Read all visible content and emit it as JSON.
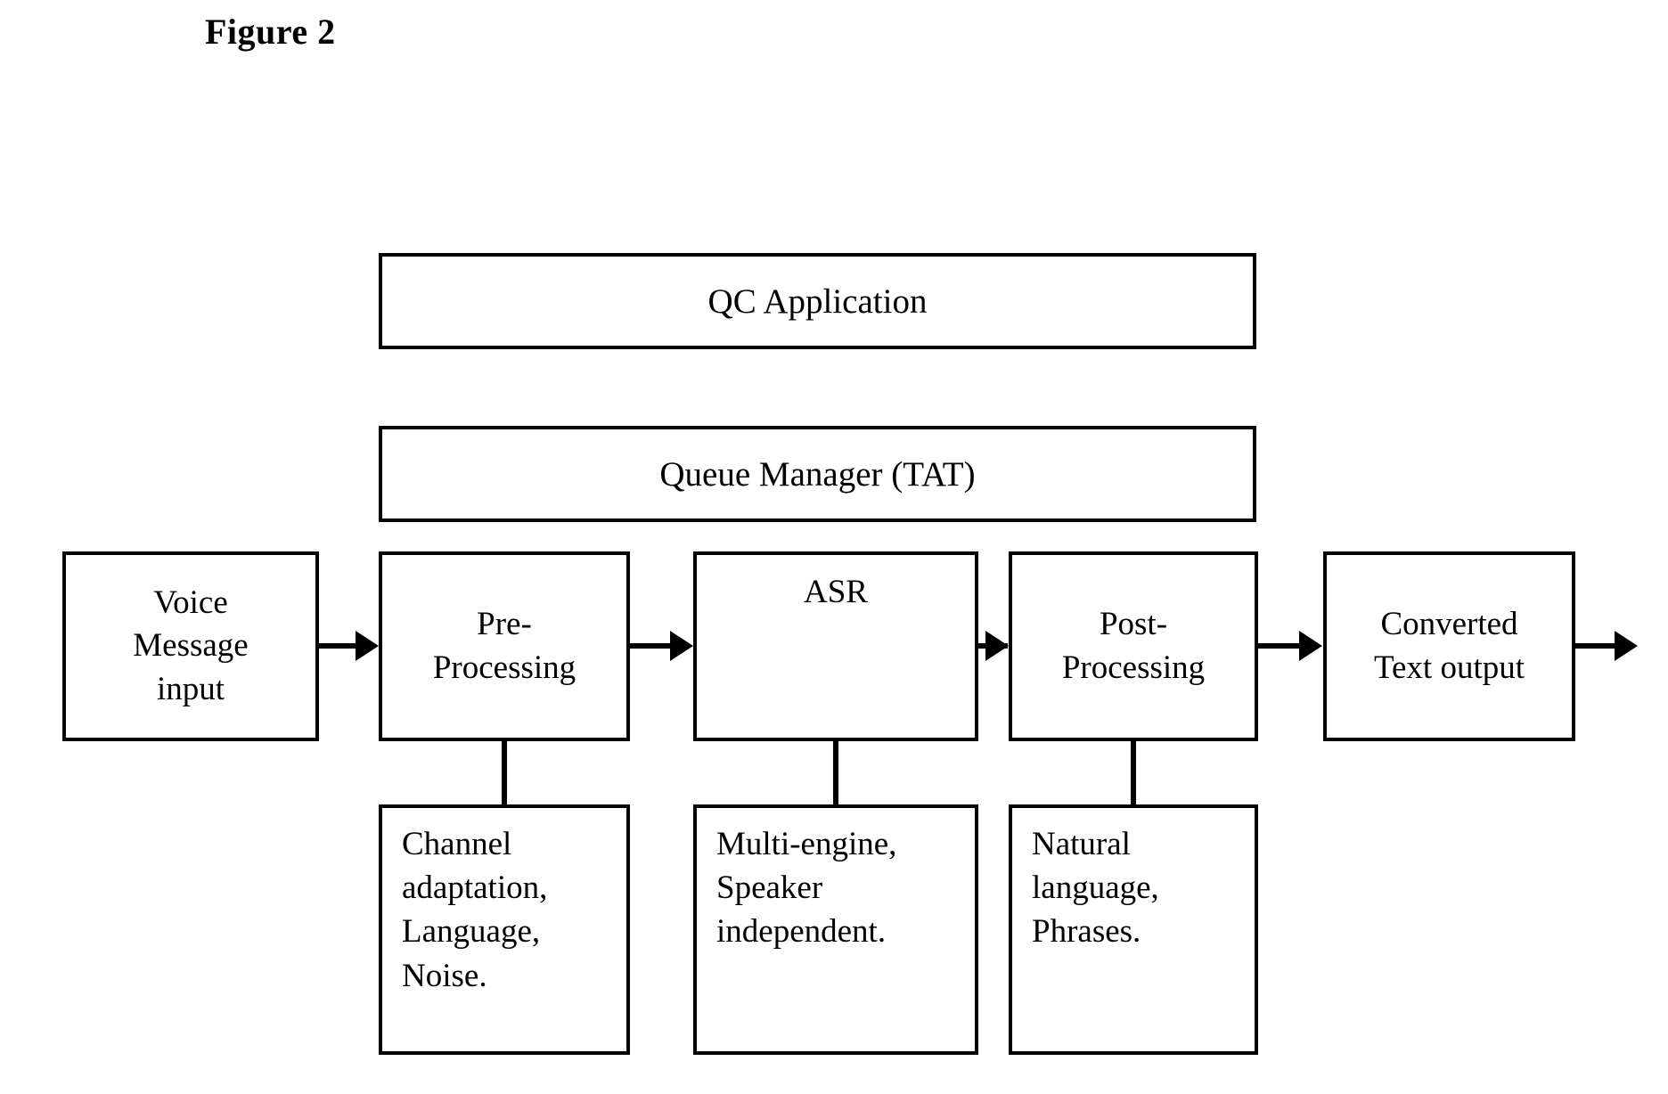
{
  "figure": {
    "title": "Figure 2"
  },
  "bands": [
    {
      "id": "qc-application",
      "label": "QC Application"
    },
    {
      "id": "queue-manager",
      "label": "Queue Manager (TAT)"
    }
  ],
  "pipeline": [
    {
      "id": "voice-message-input",
      "lines": [
        "Voice",
        "Message",
        "input"
      ]
    },
    {
      "id": "pre-processing",
      "lines": [
        "Pre-",
        "Processing"
      ]
    },
    {
      "id": "asr",
      "lines": [
        "ASR"
      ]
    },
    {
      "id": "post-processing",
      "lines": [
        "Post-",
        "Processing"
      ]
    },
    {
      "id": "converted-text-output",
      "lines": [
        "Converted",
        "Text output"
      ]
    }
  ],
  "details": [
    {
      "id": "pre-processing-details",
      "parent": "pre-processing",
      "lines": [
        "Channel",
        "adaptation,",
        "Language,",
        "Noise."
      ]
    },
    {
      "id": "asr-details",
      "parent": "asr",
      "lines": [
        "Multi-engine,",
        "Speaker",
        "independent."
      ]
    },
    {
      "id": "post-processing-details",
      "parent": "post-processing",
      "lines": [
        "Natural",
        "language,",
        "Phrases."
      ]
    }
  ],
  "flow_labels": {
    "voice_to_pre": "",
    "pre_to_asr": "",
    "asr_to_post": "",
    "post_to_output": "",
    "output_exit": ""
  },
  "colors": {
    "stroke": "#000000",
    "background": "#ffffff",
    "text": "#000000"
  }
}
